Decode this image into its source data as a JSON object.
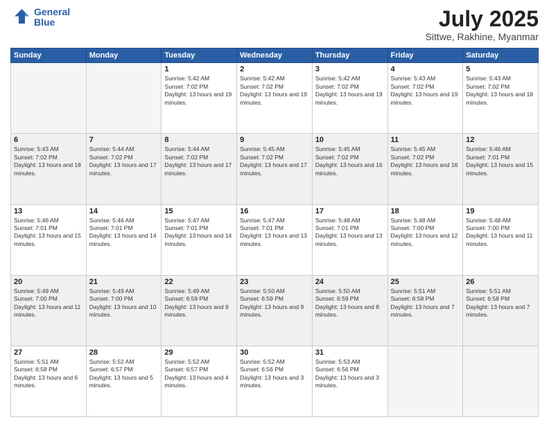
{
  "logo": {
    "line1": "General",
    "line2": "Blue"
  },
  "header": {
    "month_year": "July 2025",
    "location": "Sittwe, Rakhine, Myanmar"
  },
  "days_of_week": [
    "Sunday",
    "Monday",
    "Tuesday",
    "Wednesday",
    "Thursday",
    "Friday",
    "Saturday"
  ],
  "weeks": [
    [
      {
        "day": "",
        "empty": true
      },
      {
        "day": "",
        "empty": true
      },
      {
        "day": "1",
        "sunrise": "Sunrise: 5:42 AM",
        "sunset": "Sunset: 7:02 PM",
        "daylight": "Daylight: 13 hours and 19 minutes."
      },
      {
        "day": "2",
        "sunrise": "Sunrise: 5:42 AM",
        "sunset": "Sunset: 7:02 PM",
        "daylight": "Daylight: 13 hours and 19 minutes."
      },
      {
        "day": "3",
        "sunrise": "Sunrise: 5:42 AM",
        "sunset": "Sunset: 7:02 PM",
        "daylight": "Daylight: 13 hours and 19 minutes."
      },
      {
        "day": "4",
        "sunrise": "Sunrise: 5:43 AM",
        "sunset": "Sunset: 7:02 PM",
        "daylight": "Daylight: 13 hours and 19 minutes."
      },
      {
        "day": "5",
        "sunrise": "Sunrise: 5:43 AM",
        "sunset": "Sunset: 7:02 PM",
        "daylight": "Daylight: 13 hours and 18 minutes."
      }
    ],
    [
      {
        "day": "6",
        "sunrise": "Sunrise: 5:43 AM",
        "sunset": "Sunset: 7:02 PM",
        "daylight": "Daylight: 13 hours and 18 minutes."
      },
      {
        "day": "7",
        "sunrise": "Sunrise: 5:44 AM",
        "sunset": "Sunset: 7:02 PM",
        "daylight": "Daylight: 13 hours and 17 minutes."
      },
      {
        "day": "8",
        "sunrise": "Sunrise: 5:44 AM",
        "sunset": "Sunset: 7:02 PM",
        "daylight": "Daylight: 13 hours and 17 minutes."
      },
      {
        "day": "9",
        "sunrise": "Sunrise: 5:45 AM",
        "sunset": "Sunset: 7:02 PM",
        "daylight": "Daylight: 13 hours and 17 minutes."
      },
      {
        "day": "10",
        "sunrise": "Sunrise: 5:45 AM",
        "sunset": "Sunset: 7:02 PM",
        "daylight": "Daylight: 13 hours and 16 minutes."
      },
      {
        "day": "11",
        "sunrise": "Sunrise: 5:45 AM",
        "sunset": "Sunset: 7:02 PM",
        "daylight": "Daylight: 13 hours and 16 minutes."
      },
      {
        "day": "12",
        "sunrise": "Sunrise: 5:46 AM",
        "sunset": "Sunset: 7:01 PM",
        "daylight": "Daylight: 13 hours and 15 minutes."
      }
    ],
    [
      {
        "day": "13",
        "sunrise": "Sunrise: 5:46 AM",
        "sunset": "Sunset: 7:01 PM",
        "daylight": "Daylight: 13 hours and 15 minutes."
      },
      {
        "day": "14",
        "sunrise": "Sunrise: 5:46 AM",
        "sunset": "Sunset: 7:01 PM",
        "daylight": "Daylight: 13 hours and 14 minutes."
      },
      {
        "day": "15",
        "sunrise": "Sunrise: 5:47 AM",
        "sunset": "Sunset: 7:01 PM",
        "daylight": "Daylight: 13 hours and 14 minutes."
      },
      {
        "day": "16",
        "sunrise": "Sunrise: 5:47 AM",
        "sunset": "Sunset: 7:01 PM",
        "daylight": "Daylight: 13 hours and 13 minutes."
      },
      {
        "day": "17",
        "sunrise": "Sunrise: 5:48 AM",
        "sunset": "Sunset: 7:01 PM",
        "daylight": "Daylight: 13 hours and 13 minutes."
      },
      {
        "day": "18",
        "sunrise": "Sunrise: 5:48 AM",
        "sunset": "Sunset: 7:00 PM",
        "daylight": "Daylight: 13 hours and 12 minutes."
      },
      {
        "day": "19",
        "sunrise": "Sunrise: 5:48 AM",
        "sunset": "Sunset: 7:00 PM",
        "daylight": "Daylight: 13 hours and 11 minutes."
      }
    ],
    [
      {
        "day": "20",
        "sunrise": "Sunrise: 5:49 AM",
        "sunset": "Sunset: 7:00 PM",
        "daylight": "Daylight: 13 hours and 11 minutes."
      },
      {
        "day": "21",
        "sunrise": "Sunrise: 5:49 AM",
        "sunset": "Sunset: 7:00 PM",
        "daylight": "Daylight: 13 hours and 10 minutes."
      },
      {
        "day": "22",
        "sunrise": "Sunrise: 5:49 AM",
        "sunset": "Sunset: 6:59 PM",
        "daylight": "Daylight: 13 hours and 9 minutes."
      },
      {
        "day": "23",
        "sunrise": "Sunrise: 5:50 AM",
        "sunset": "Sunset: 6:59 PM",
        "daylight": "Daylight: 13 hours and 9 minutes."
      },
      {
        "day": "24",
        "sunrise": "Sunrise: 5:50 AM",
        "sunset": "Sunset: 6:59 PM",
        "daylight": "Daylight: 13 hours and 8 minutes."
      },
      {
        "day": "25",
        "sunrise": "Sunrise: 5:51 AM",
        "sunset": "Sunset: 6:58 PM",
        "daylight": "Daylight: 13 hours and 7 minutes."
      },
      {
        "day": "26",
        "sunrise": "Sunrise: 5:51 AM",
        "sunset": "Sunset: 6:58 PM",
        "daylight": "Daylight: 13 hours and 7 minutes."
      }
    ],
    [
      {
        "day": "27",
        "sunrise": "Sunrise: 5:51 AM",
        "sunset": "Sunset: 6:58 PM",
        "daylight": "Daylight: 13 hours and 6 minutes."
      },
      {
        "day": "28",
        "sunrise": "Sunrise: 5:52 AM",
        "sunset": "Sunset: 6:57 PM",
        "daylight": "Daylight: 13 hours and 5 minutes."
      },
      {
        "day": "29",
        "sunrise": "Sunrise: 5:52 AM",
        "sunset": "Sunset: 6:57 PM",
        "daylight": "Daylight: 13 hours and 4 minutes."
      },
      {
        "day": "30",
        "sunrise": "Sunrise: 5:52 AM",
        "sunset": "Sunset: 6:56 PM",
        "daylight": "Daylight: 13 hours and 3 minutes."
      },
      {
        "day": "31",
        "sunrise": "Sunrise: 5:53 AM",
        "sunset": "Sunset: 6:56 PM",
        "daylight": "Daylight: 13 hours and 3 minutes."
      },
      {
        "day": "",
        "empty": true
      },
      {
        "day": "",
        "empty": true
      }
    ]
  ]
}
